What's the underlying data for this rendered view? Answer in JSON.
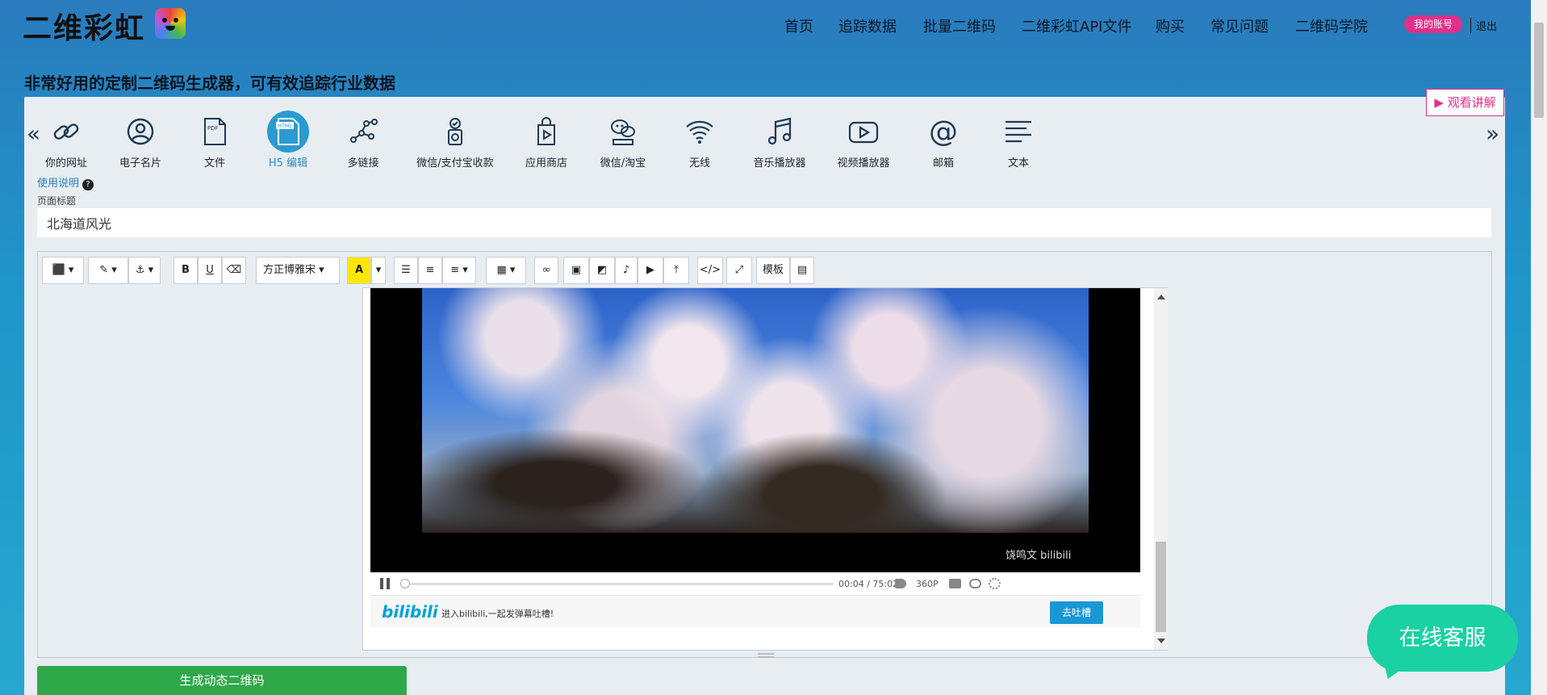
{
  "header": {
    "logo_text": "二维彩虹",
    "nav": [
      "首页",
      "追踪数据",
      "批量二维码",
      "二维彩虹API文件",
      "购买",
      "常见问题",
      "二维码学院"
    ],
    "account_label": "我的账号",
    "logout_label": "退出"
  },
  "tagline": "非常好用的定制二维码生成器，可有效追踪行业数据",
  "watch_label": "▶ 观看讲解",
  "types": [
    {
      "label": "你的网址",
      "icon": "link-icon"
    },
    {
      "label": "电子名片",
      "icon": "user-icon"
    },
    {
      "label": "文件",
      "icon": "pdf-icon"
    },
    {
      "label": "H5 编辑",
      "icon": "html-icon",
      "active": true
    },
    {
      "label": "多链接",
      "icon": "network-icon"
    },
    {
      "label": "微信/支付宝收款",
      "icon": "payment-icon"
    },
    {
      "label": "应用商店",
      "icon": "app-store-icon"
    },
    {
      "label": "微信/淘宝",
      "icon": "wechat-icon"
    },
    {
      "label": "无线",
      "icon": "wifi-icon"
    },
    {
      "label": "音乐播放器",
      "icon": "music-icon"
    },
    {
      "label": "视频播放器",
      "icon": "video-icon"
    },
    {
      "label": "邮箱",
      "icon": "email-icon"
    },
    {
      "label": "文本",
      "icon": "text-icon"
    }
  ],
  "help_label": "使用说明",
  "page_title_label": "页面标题",
  "page_title_value": "北海道风光",
  "toolbar": {
    "font_label": "方正博雅宋 ▾",
    "template_label": "模板"
  },
  "video": {
    "watermark": "饶鸣文 bilibili",
    "time_current": "00:04",
    "time_total": "75:02",
    "time_display": "00:04 / 75:02",
    "quality": "360P",
    "progress_fraction": 0.001,
    "logo": "bilibili",
    "danmu_hint": "进入bilibili,一起发弹幕吐槽!",
    "send_label": "去吐槽"
  },
  "generate_label": "生成动态二维码",
  "chat_label": "在线客服",
  "colors": {
    "accent": "#2a9ad0",
    "account": "#e1308a",
    "generate": "#2fa84a",
    "chat": "#19d1a3"
  }
}
